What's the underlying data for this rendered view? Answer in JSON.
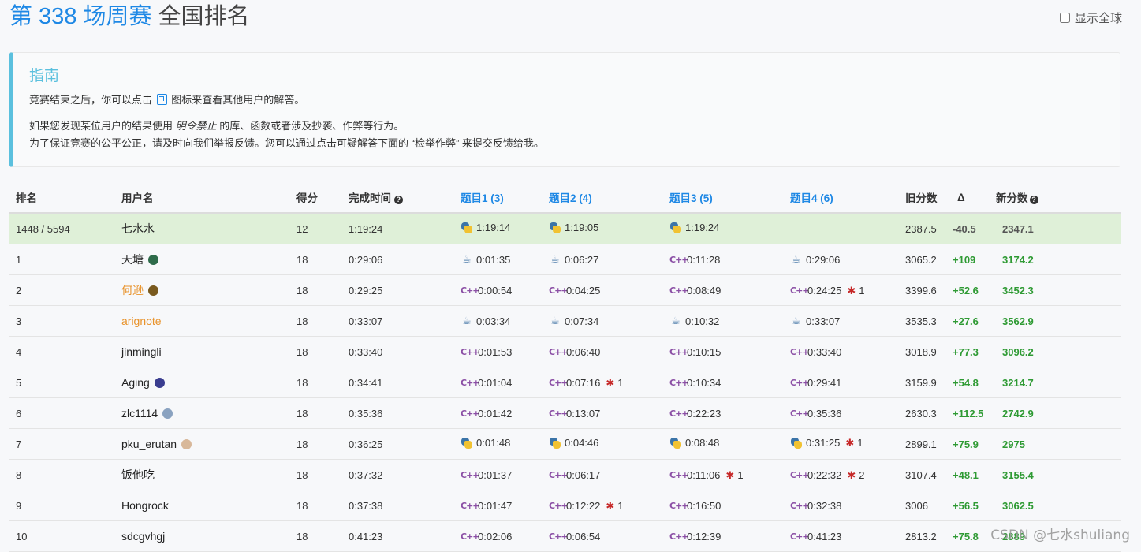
{
  "header": {
    "contest": "第 338 场周赛",
    "ranking": "全国排名",
    "global_label": "显示全球"
  },
  "guide": {
    "title": "指南",
    "line1_a": "竞赛结束之后，你可以点击",
    "line1_b": "图标来查看其他用户的解答。",
    "line2_a": "如果您发现某位用户的结果使用",
    "line2_em": "明令禁止",
    "line2_b": "的库、函数或者涉及抄袭、作弊等行为。",
    "line3": "为了保证竞赛的公平公正，请及时向我们举报反馈。您可以通过点击可疑解答下面的 “检举作弊” 来提交反馈给我。"
  },
  "table": {
    "headers": {
      "rank": "排名",
      "user": "用户名",
      "score": "得分",
      "time": "完成时间",
      "q1": "题目1 (3)",
      "q2": "题目2 (4)",
      "q3": "题目3 (5)",
      "q4": "题目4 (6)",
      "old": "旧分数",
      "delta": "Δ",
      "new": "新分数"
    },
    "rows": [
      {
        "rank": "1448 / 5594",
        "user": "七水水",
        "score": "12",
        "time": "1:19:24",
        "q": [
          {
            "lang": "py",
            "time": "1:19:14",
            "bugs": ""
          },
          {
            "lang": "py",
            "time": "1:19:05",
            "bugs": ""
          },
          {
            "lang": "py",
            "time": "1:19:24",
            "bugs": ""
          },
          {
            "lang": "",
            "time": "",
            "bugs": ""
          }
        ],
        "old": "2387.5",
        "delta": "-40.5",
        "new": "2347.1"
      },
      {
        "rank": "1",
        "user": "天塘",
        "score": "18",
        "time": "0:29:06",
        "q": [
          {
            "lang": "java",
            "time": "0:01:35",
            "bugs": ""
          },
          {
            "lang": "java",
            "time": "0:06:27",
            "bugs": ""
          },
          {
            "lang": "cpp",
            "time": "0:11:28",
            "bugs": ""
          },
          {
            "lang": "java",
            "time": "0:29:06",
            "bugs": ""
          }
        ],
        "old": "3065.2",
        "delta": "+109",
        "new": "3174.2"
      },
      {
        "rank": "2",
        "user": "何逊",
        "score": "18",
        "time": "0:29:25",
        "q": [
          {
            "lang": "cpp",
            "time": "0:00:54",
            "bugs": ""
          },
          {
            "lang": "cpp",
            "time": "0:04:25",
            "bugs": ""
          },
          {
            "lang": "cpp",
            "time": "0:08:49",
            "bugs": ""
          },
          {
            "lang": "cpp",
            "time": "0:24:25",
            "bugs": "1"
          }
        ],
        "old": "3399.6",
        "delta": "+52.6",
        "new": "3452.3"
      },
      {
        "rank": "3",
        "user": "arignote",
        "score": "18",
        "time": "0:33:07",
        "q": [
          {
            "lang": "java",
            "time": "0:03:34",
            "bugs": ""
          },
          {
            "lang": "java",
            "time": "0:07:34",
            "bugs": ""
          },
          {
            "lang": "java",
            "time": "0:10:32",
            "bugs": ""
          },
          {
            "lang": "java",
            "time": "0:33:07",
            "bugs": ""
          }
        ],
        "old": "3535.3",
        "delta": "+27.6",
        "new": "3562.9"
      },
      {
        "rank": "4",
        "user": "jinmingli",
        "score": "18",
        "time": "0:33:40",
        "q": [
          {
            "lang": "cpp",
            "time": "0:01:53",
            "bugs": ""
          },
          {
            "lang": "cpp",
            "time": "0:06:40",
            "bugs": ""
          },
          {
            "lang": "cpp",
            "time": "0:10:15",
            "bugs": ""
          },
          {
            "lang": "cpp",
            "time": "0:33:40",
            "bugs": ""
          }
        ],
        "old": "3018.9",
        "delta": "+77.3",
        "new": "3096.2"
      },
      {
        "rank": "5",
        "user": "Aging",
        "score": "18",
        "time": "0:34:41",
        "q": [
          {
            "lang": "cpp",
            "time": "0:01:04",
            "bugs": ""
          },
          {
            "lang": "cpp",
            "time": "0:07:16",
            "bugs": "1"
          },
          {
            "lang": "cpp",
            "time": "0:10:34",
            "bugs": ""
          },
          {
            "lang": "cpp",
            "time": "0:29:41",
            "bugs": ""
          }
        ],
        "old": "3159.9",
        "delta": "+54.8",
        "new": "3214.7"
      },
      {
        "rank": "6",
        "user": "zlc1114",
        "score": "18",
        "time": "0:35:36",
        "q": [
          {
            "lang": "cpp",
            "time": "0:01:42",
            "bugs": ""
          },
          {
            "lang": "cpp",
            "time": "0:13:07",
            "bugs": ""
          },
          {
            "lang": "cpp",
            "time": "0:22:23",
            "bugs": ""
          },
          {
            "lang": "cpp",
            "time": "0:35:36",
            "bugs": ""
          }
        ],
        "old": "2630.3",
        "delta": "+112.5",
        "new": "2742.9"
      },
      {
        "rank": "7",
        "user": "pku_erutan",
        "score": "18",
        "time": "0:36:25",
        "q": [
          {
            "lang": "py",
            "time": "0:01:48",
            "bugs": ""
          },
          {
            "lang": "py",
            "time": "0:04:46",
            "bugs": ""
          },
          {
            "lang": "py",
            "time": "0:08:48",
            "bugs": ""
          },
          {
            "lang": "py",
            "time": "0:31:25",
            "bugs": "1"
          }
        ],
        "old": "2899.1",
        "delta": "+75.9",
        "new": "2975"
      },
      {
        "rank": "8",
        "user": "饭他吃",
        "score": "18",
        "time": "0:37:32",
        "q": [
          {
            "lang": "cpp",
            "time": "0:01:37",
            "bugs": ""
          },
          {
            "lang": "cpp",
            "time": "0:06:17",
            "bugs": ""
          },
          {
            "lang": "cpp",
            "time": "0:11:06",
            "bugs": "1"
          },
          {
            "lang": "cpp",
            "time": "0:22:32",
            "bugs": "2"
          }
        ],
        "old": "3107.4",
        "delta": "+48.1",
        "new": "3155.4"
      },
      {
        "rank": "9",
        "user": "Hongrock",
        "score": "18",
        "time": "0:37:38",
        "q": [
          {
            "lang": "cpp",
            "time": "0:01:47",
            "bugs": ""
          },
          {
            "lang": "cpp",
            "time": "0:12:22",
            "bugs": "1"
          },
          {
            "lang": "cpp",
            "time": "0:16:50",
            "bugs": ""
          },
          {
            "lang": "cpp",
            "time": "0:32:38",
            "bugs": ""
          }
        ],
        "old": "3006",
        "delta": "+56.5",
        "new": "3062.5"
      },
      {
        "rank": "10",
        "user": "sdcgvhgj",
        "score": "18",
        "time": "0:41:23",
        "q": [
          {
            "lang": "cpp",
            "time": "0:02:06",
            "bugs": ""
          },
          {
            "lang": "cpp",
            "time": "0:06:54",
            "bugs": ""
          },
          {
            "lang": "cpp",
            "time": "0:12:39",
            "bugs": ""
          },
          {
            "lang": "cpp",
            "time": "0:41:23",
            "bugs": ""
          }
        ],
        "old": "2813.2",
        "delta": "+75.8",
        "new": "2889"
      }
    ]
  },
  "user_styles": {
    "何逊": {
      "color": "orange",
      "badge": "#7a5a1e"
    },
    "arignote": {
      "color": "orange",
      "badge": ""
    },
    "天塘": {
      "color": "",
      "badge": "#2e6b4a"
    },
    "Aging": {
      "color": "",
      "badge": "#3a3d8f"
    },
    "zlc1114": {
      "color": "",
      "badge": "#8aa2c0"
    },
    "pku_erutan": {
      "color": "",
      "badge": "#d8b89a"
    }
  },
  "watermark": "CSDN @七水shuliang",
  "colors": {
    "accent": "#1e88e5",
    "guide_border": "#5bc0de",
    "my_row": "#dff0d8",
    "positive": "#2e9a33",
    "cpp": "#8b4fa5"
  }
}
